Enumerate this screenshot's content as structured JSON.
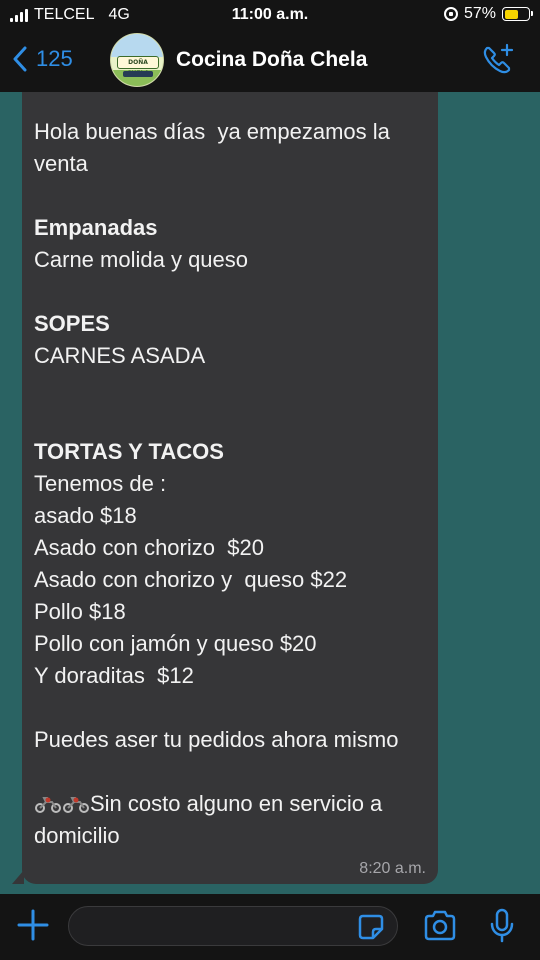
{
  "status_bar": {
    "carrier": "TELCEL",
    "network": "4G",
    "time": "11:00 a.m.",
    "battery_percent": "57%",
    "battery_level": 0.57
  },
  "header": {
    "back_count": "125",
    "contact_name": "Cocina Doña Chela",
    "avatar_logo_text": "DOÑA CHELA"
  },
  "message": {
    "greeting": "Hola buenas días  ya empezamos la venta",
    "section1_title": "Empanadas",
    "section1_body": "Carne molida y queso",
    "section2_title": "SOPES",
    "section2_body": "CARNES ASADA",
    "section3_title": "TORTAS Y TACOS",
    "section3_lines": [
      "Tenemos de :",
      "asado $18",
      "Asado con chorizo  $20",
      "Asado con chorizo y  queso $22",
      "Pollo $18",
      "Pollo con jamón y queso $20",
      "Y doraditas  $12"
    ],
    "order_note": "Puedes aser tu pedidos ahora mismo",
    "delivery_note": "Sin costo alguno en servicio a domicilio",
    "timestamp": "8:20 a.m."
  },
  "composer": {
    "placeholder": ""
  },
  "colors": {
    "accent": "#2f8ee5",
    "bubble": "#363638",
    "chat_background": "#2a6363",
    "bars": "#141414"
  },
  "icons": [
    "signal-icon",
    "rotation-lock-icon",
    "battery-icon",
    "back-chevron-icon",
    "add-call-icon",
    "plus-icon",
    "sticker-icon",
    "camera-icon",
    "microphone-icon",
    "motorcycle-icon"
  ]
}
